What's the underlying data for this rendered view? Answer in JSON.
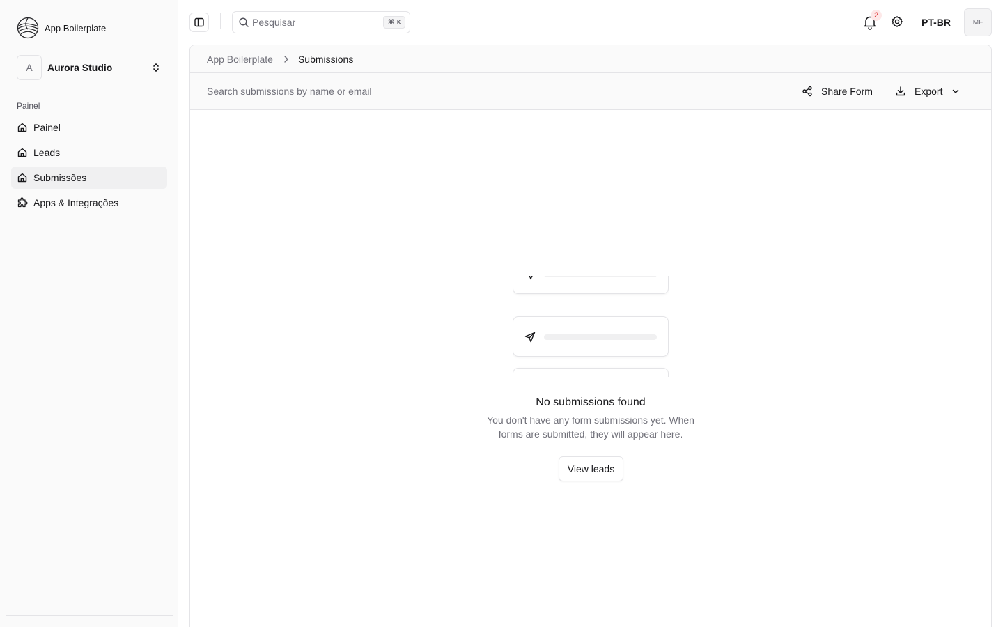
{
  "sidebar": {
    "brand_name": "App Boilerplate",
    "org": {
      "initial": "A",
      "name": "Aurora Studio"
    },
    "section_label": "Painel",
    "items": [
      {
        "label": "Painel",
        "icon": "home-icon",
        "active": false
      },
      {
        "label": "Leads",
        "icon": "home-icon",
        "active": false
      },
      {
        "label": "Submissões",
        "icon": "home-icon",
        "active": true
      },
      {
        "label": "Apps & Integrações",
        "icon": "puzzle-icon",
        "active": false
      }
    ]
  },
  "topbar": {
    "search_placeholder": "Pesquisar",
    "shortcut_symbol": "⌘",
    "shortcut_key": "K",
    "notifications_count": "2",
    "language": "PT-BR",
    "user_initials": "MF"
  },
  "breadcrumb": {
    "root": "App Boilerplate",
    "current": "Submissions"
  },
  "toolbar": {
    "search_placeholder": "Search submissions by name or email",
    "share_label": "Share Form",
    "export_label": "Export"
  },
  "empty_state": {
    "title": "No submissions found",
    "description": "You don't have any form submissions yet. When forms are submitted, they will appear here.",
    "button_label": "View leads"
  },
  "colors": {
    "sidebar_bg": "#fafafa",
    "border": "#e4e4e7",
    "muted_text": "#71717a",
    "badge_text": "#dc2626",
    "active_item_bg": "#f0f0f1"
  }
}
